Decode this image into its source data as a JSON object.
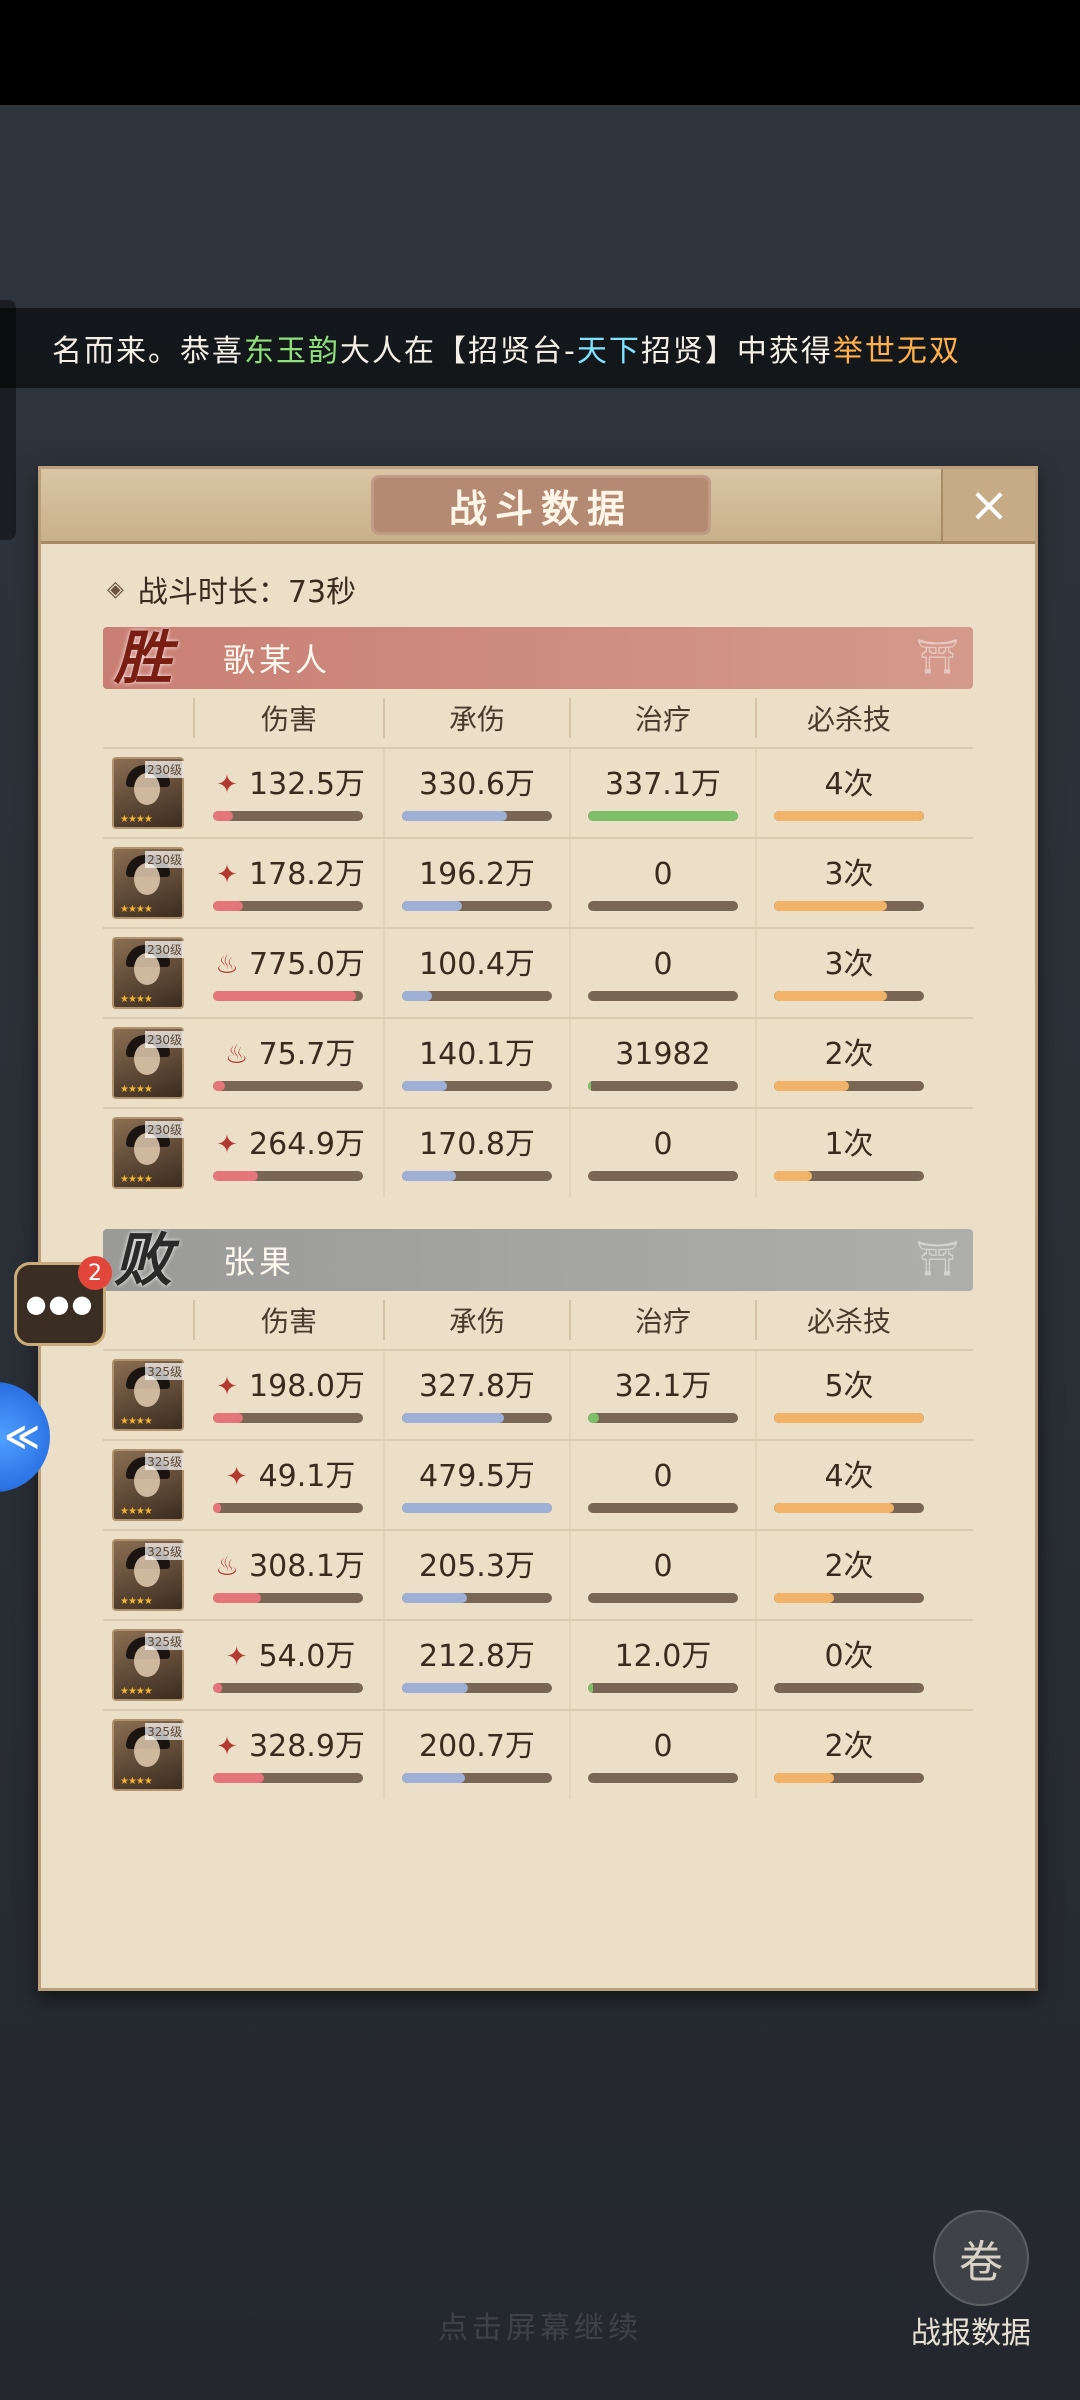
{
  "marquee": {
    "prefix": "名而来。恭喜",
    "player": "东玉韵",
    "mid": "大人在【招贤台-",
    "place": "天下",
    "suffix": "招贤】中获得",
    "reward": "举世无双"
  },
  "panel": {
    "title": "战斗数据",
    "close_icon": "×",
    "duration": "战斗时长：73秒"
  },
  "columns": [
    "伤害",
    "承伤",
    "治疗",
    "必杀技"
  ],
  "win_team": {
    "badge": "胜",
    "name": "歌某人",
    "rows": [
      {
        "level": "230级",
        "icon": "✦",
        "damage": "132.5万",
        "taken": "330.6万",
        "heal": "337.1万",
        "ult": "4次",
        "bars": {
          "damage": 0.13,
          "taken": 0.7,
          "heal": 1.0,
          "ult": 1.0
        }
      },
      {
        "level": "230级",
        "icon": "✦",
        "damage": "178.2万",
        "taken": "196.2万",
        "heal": "0",
        "ult": "3次",
        "bars": {
          "damage": 0.2,
          "taken": 0.4,
          "heal": 0,
          "ult": 0.75
        }
      },
      {
        "level": "230级",
        "icon": "♨",
        "damage": "775.0万",
        "taken": "100.4万",
        "heal": "0",
        "ult": "3次",
        "bars": {
          "damage": 0.95,
          "taken": 0.2,
          "heal": 0,
          "ult": 0.75
        }
      },
      {
        "level": "230级",
        "icon": "♨",
        "damage": "75.7万",
        "taken": "140.1万",
        "heal": "31982",
        "ult": "2次",
        "bars": {
          "damage": 0.08,
          "taken": 0.3,
          "heal": 0.02,
          "ult": 0.5
        }
      },
      {
        "level": "230级",
        "icon": "✦",
        "damage": "264.9万",
        "taken": "170.8万",
        "heal": "0",
        "ult": "1次",
        "bars": {
          "damage": 0.3,
          "taken": 0.36,
          "heal": 0,
          "ult": 0.25
        }
      }
    ]
  },
  "lose_team": {
    "badge": "败",
    "name": "张果",
    "rows": [
      {
        "level": "325级",
        "icon": "✦",
        "damage": "198.0万",
        "taken": "327.8万",
        "heal": "32.1万",
        "ult": "5次",
        "bars": {
          "damage": 0.2,
          "taken": 0.68,
          "heal": 0.07,
          "ult": 1.0
        }
      },
      {
        "level": "325级",
        "icon": "✦",
        "damage": "49.1万",
        "taken": "479.5万",
        "heal": "0",
        "ult": "4次",
        "bars": {
          "damage": 0.05,
          "taken": 1.0,
          "heal": 0,
          "ult": 0.8
        }
      },
      {
        "level": "325级",
        "icon": "♨",
        "damage": "308.1万",
        "taken": "205.3万",
        "heal": "0",
        "ult": "2次",
        "bars": {
          "damage": 0.32,
          "taken": 0.43,
          "heal": 0,
          "ult": 0.4
        }
      },
      {
        "level": "325级",
        "icon": "✦",
        "damage": "54.0万",
        "taken": "212.8万",
        "heal": "12.0万",
        "ult": "0次",
        "bars": {
          "damage": 0.06,
          "taken": 0.44,
          "heal": 0.03,
          "ult": 0
        }
      },
      {
        "level": "325级",
        "icon": "✦",
        "damage": "328.9万",
        "taken": "200.7万",
        "heal": "0",
        "ult": "2次",
        "bars": {
          "damage": 0.34,
          "taken": 0.42,
          "heal": 0,
          "ult": 0.4
        }
      }
    ]
  },
  "chat": {
    "badge": "2",
    "icon": "chat-bubble-icon"
  },
  "side_button": {
    "icon": "speed-icon",
    "glyph": "≪"
  },
  "footer": {
    "continue_hint": "点击屏幕继续",
    "report_label": "战报数据",
    "report_icon": "scroll-icon"
  }
}
